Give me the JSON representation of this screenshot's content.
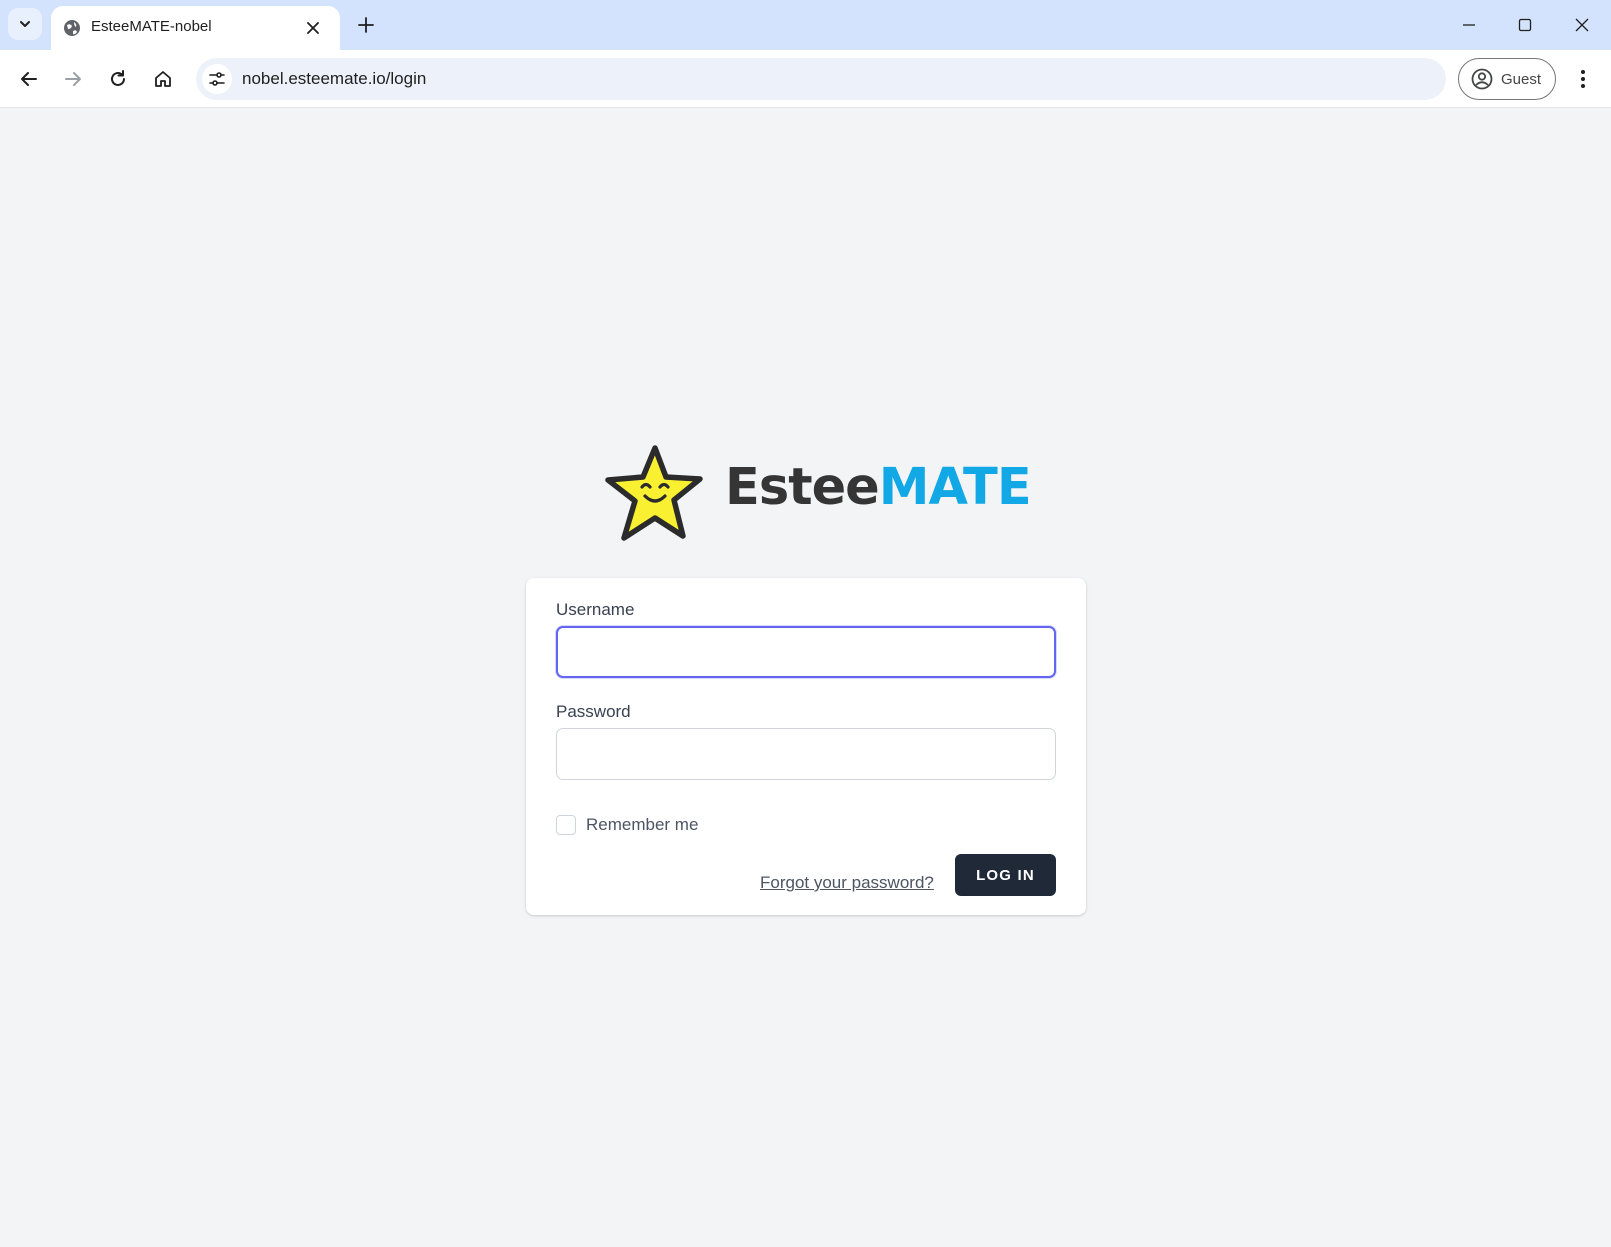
{
  "browser": {
    "tab_title": "EsteeMATE-nobel",
    "url": "nobel.esteemate.io/login",
    "profile_label": "Guest",
    "icons": {
      "tab_search": "chevron-down-icon",
      "favicon": "globe-icon",
      "tab_close": "close-icon",
      "new_tab": "plus-icon",
      "minimize": "minimize-icon",
      "maximize": "maximize-icon",
      "close_window": "close-icon",
      "back": "arrow-left-icon",
      "forward": "arrow-right-icon",
      "reload": "reload-icon",
      "home": "home-icon",
      "site_info": "tune-icon",
      "profile": "account-circle-icon",
      "menu": "more-vert-icon"
    }
  },
  "logo": {
    "text_part1": "Estee",
    "text_part2": "MATE",
    "colors": {
      "star": "#f9f031",
      "part1": "#353535",
      "part2": "#12a8e6"
    }
  },
  "form": {
    "username_label": "Username",
    "username_value": "",
    "password_label": "Password",
    "password_value": "",
    "remember_label": "Remember me",
    "remember_checked": false,
    "forgot_link": "Forgot your password?",
    "login_button": "LOG IN"
  },
  "colors": {
    "page_bg": "#f3f4f6",
    "focus_ring": "#6366f1",
    "button_bg": "#1f2937",
    "chrome_bg": "#d3e3fd"
  }
}
